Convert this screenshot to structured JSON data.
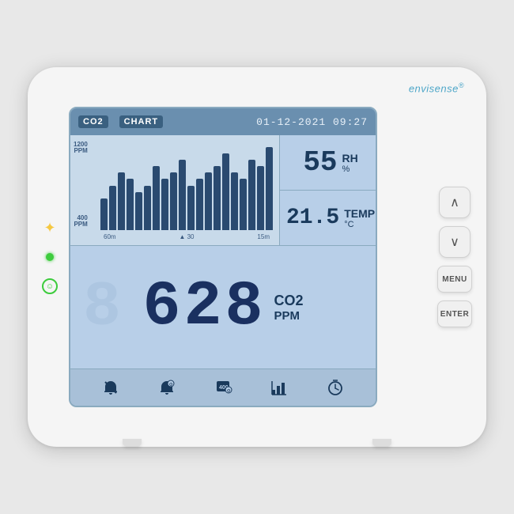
{
  "brand": {
    "name": "envisense",
    "trademark": "®"
  },
  "screen": {
    "header": {
      "co2_label": "CO2",
      "chart_label": "CHART",
      "datetime": "01-12-2021 09:27"
    },
    "chart": {
      "y_labels": [
        "1200\nPPM",
        "400\nPPM"
      ],
      "y_top": "1200",
      "y_top_unit": "PPM",
      "y_bottom": "400",
      "y_bottom_unit": "PPM",
      "x_labels": [
        "60m",
        "30",
        "15m"
      ],
      "bars": [
        5,
        7,
        9,
        8,
        6,
        7,
        10,
        8,
        9,
        11,
        7,
        8,
        9,
        10,
        12,
        9,
        8,
        11,
        10,
        13
      ]
    },
    "rh": {
      "value": "55",
      "unit": "RH",
      "sub": "%"
    },
    "temp": {
      "value": "21.5",
      "unit": "TEMP",
      "sub": "°C"
    },
    "co2": {
      "value": "628",
      "label": "CO2",
      "sub": "PPM"
    },
    "footer_icons": [
      {
        "name": "alarm-off-icon",
        "symbol": "🔕"
      },
      {
        "name": "alarm-settings-icon",
        "symbol": "🔔"
      },
      {
        "name": "calibration-icon",
        "symbol": "⚙"
      },
      {
        "name": "chart-icon",
        "symbol": "📊"
      },
      {
        "name": "timer-icon",
        "symbol": "🕐"
      }
    ]
  },
  "buttons": {
    "up_label": "∧",
    "down_label": "∨",
    "menu_label": "MENU",
    "enter_label": "ENTER"
  },
  "indicators": {
    "sun": "✦",
    "smiley": "☺"
  }
}
